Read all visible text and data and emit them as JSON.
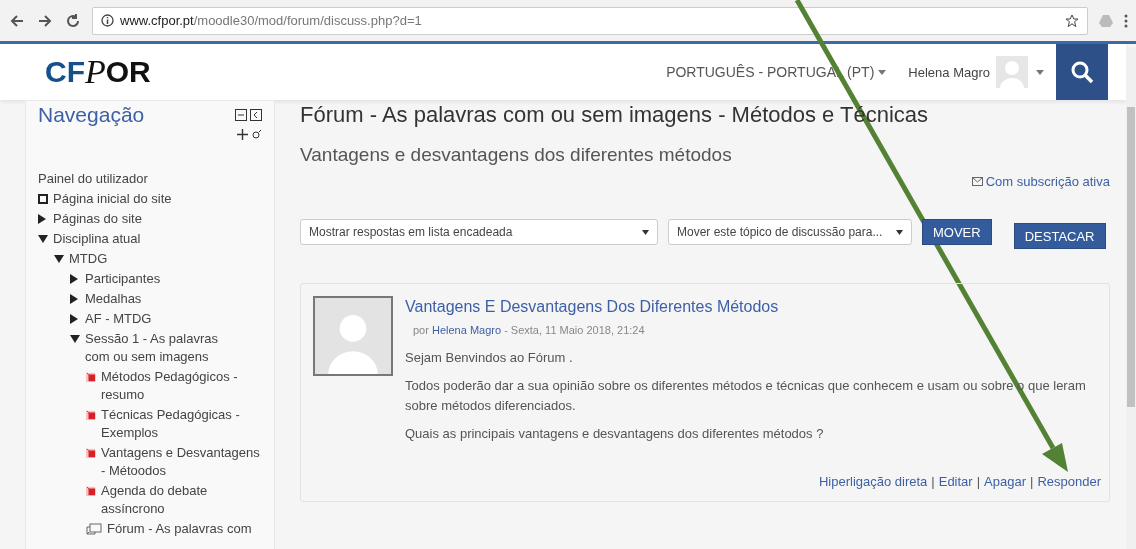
{
  "browser": {
    "url_host": "www.cfpor.pt",
    "url_path": "/moodle30/mod/forum/discuss.php?d=1"
  },
  "header": {
    "logo_prefix": "CF",
    "logo_glyph": "P",
    "logo_suffix": "OR",
    "language": "PORTUGUÊS - PORTUGAL (PT)",
    "user": "Helena Magro"
  },
  "navigation": {
    "title": "Navegação",
    "items": [
      {
        "label": "Painel do utilizador",
        "kind": "link"
      },
      {
        "label": "Página inicial do site",
        "kind": "home"
      },
      {
        "label": "Páginas do site",
        "kind": "branch",
        "expanded": false
      },
      {
        "label": "Disciplina atual",
        "kind": "branch",
        "expanded": true,
        "children": [
          {
            "label": "MTDG",
            "kind": "branch",
            "expanded": true,
            "children": [
              {
                "label": "Participantes",
                "kind": "branch",
                "expanded": false
              },
              {
                "label": "Medalhas",
                "kind": "branch",
                "expanded": false
              },
              {
                "label": "AF - MTDG",
                "kind": "branch",
                "expanded": false
              },
              {
                "label": "Sessão 1 - As palavras com ou sem imagens",
                "kind": "branch",
                "expanded": true,
                "children": [
                  {
                    "label": "Métodos Pedagógicos - resumo",
                    "kind": "pdf"
                  },
                  {
                    "label": "Técnicas Pedagógicas - Exemplos",
                    "kind": "pdf"
                  },
                  {
                    "label": "Vantagens e Desvantagens - Métoodos",
                    "kind": "pdf"
                  },
                  {
                    "label": "Agenda do debate assíncrono",
                    "kind": "pdf"
                  },
                  {
                    "label": "Fórum - As palavras com",
                    "kind": "forum"
                  }
                ]
              }
            ]
          }
        ]
      }
    ]
  },
  "page": {
    "forum_title": "Fórum - As palavras com ou sem imagens - Métodos e Técnicas",
    "discussion_title": "Vantagens e desvantagens dos diferentes métodos",
    "subscription": "Com subscrição ativa",
    "display_select": "Mostrar respostas em lista encadeada",
    "move_select": "Mover este tópico de discussão para...",
    "move_button": "MOVER",
    "pin_button": "DESTACAR"
  },
  "post": {
    "title": "Vantagens E Desvantagens Dos Diferentes Métodos",
    "by": "por",
    "author": "Helena Magro",
    "date": "- Sexta, 11 Maio 2018, 21:24",
    "paragraphs": [
      "Sejam Benvindos ao Fórum .",
      "Todos poderão dar a sua opinião sobre os diferentes métodos e técnicas que conhecem e usam ou sobre o que leram sobre métodos diferenciados.",
      "Quais as principais vantagens e desvantagens dos diferentes métodos ?"
    ],
    "links": [
      "Hiperligação direta",
      "Editar",
      "Apagar",
      "Responder"
    ],
    "separator": "|"
  }
}
